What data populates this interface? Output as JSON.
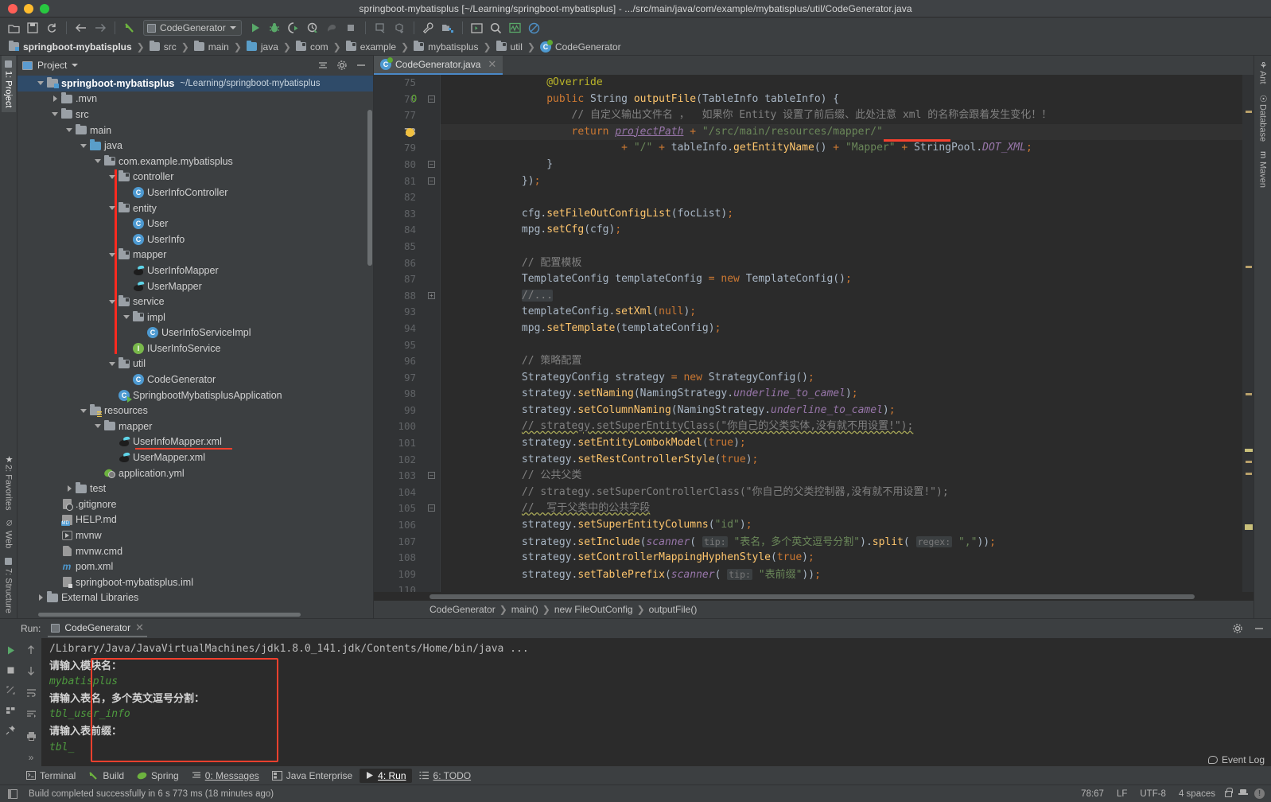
{
  "window": {
    "title": "springboot-mybatisplus [~/Learning/springboot-mybatisplus] - .../src/main/java/com/example/mybatisplus/util/CodeGenerator.java"
  },
  "toolbar": {
    "run_config": "CodeGenerator",
    "icons": [
      "open-folder-icon",
      "save-icon",
      "sync-icon",
      "back-arrow-icon",
      "forward-arrow-icon",
      "undo-icon",
      "run-icon",
      "debug-icon",
      "run-coverage-icon",
      "profile-icon",
      "stop-icon-dark",
      "stop-icon",
      "build-icon",
      "update-icon",
      "wrench-icon",
      "project-structure-icon",
      "console-icon",
      "search-icon",
      "monitor-icon",
      "block-icon"
    ]
  },
  "navbar": {
    "crumbs": [
      {
        "label": "springboot-mybatisplus",
        "icon": "module-icon"
      },
      {
        "label": "src",
        "icon": "folder-icon"
      },
      {
        "label": "main",
        "icon": "folder-icon"
      },
      {
        "label": "java",
        "icon": "source-folder-icon"
      },
      {
        "label": "com",
        "icon": "package-icon"
      },
      {
        "label": "example",
        "icon": "package-icon"
      },
      {
        "label": "mybatisplus",
        "icon": "package-icon"
      },
      {
        "label": "util",
        "icon": "package-icon"
      },
      {
        "label": "CodeGenerator",
        "icon": "java-class-icon"
      }
    ]
  },
  "left_rail": {
    "top": [
      {
        "label": "1: Project",
        "active": true
      }
    ],
    "bottom": [
      {
        "label": "2: Favorites"
      },
      {
        "label": "Web"
      },
      {
        "label": "7: Structure"
      }
    ]
  },
  "right_rail": {
    "items": [
      {
        "label": "Ant"
      },
      {
        "label": "Database"
      },
      {
        "label": "Maven"
      }
    ]
  },
  "project_panel": {
    "title": "Project",
    "tree": [
      {
        "indent": 0,
        "arrow": "down",
        "icon": "module-icon",
        "label": "springboot-mybatisplus",
        "path": "~/Learning/springboot-mybatisplus",
        "selected": true,
        "bold": true
      },
      {
        "indent": 1,
        "arrow": "right",
        "icon": "folder-icon",
        "label": ".mvn"
      },
      {
        "indent": 1,
        "arrow": "down",
        "icon": "folder-icon",
        "label": "src"
      },
      {
        "indent": 2,
        "arrow": "down",
        "icon": "folder-icon",
        "label": "main"
      },
      {
        "indent": 3,
        "arrow": "down",
        "icon": "source-folder-icon",
        "label": "java"
      },
      {
        "indent": 4,
        "arrow": "down",
        "icon": "package-icon",
        "label": "com.example.mybatisplus"
      },
      {
        "indent": 5,
        "arrow": "down",
        "icon": "package-icon",
        "label": "controller"
      },
      {
        "indent": 6,
        "arrow": "none",
        "icon": "java-class-icon",
        "label": "UserInfoController"
      },
      {
        "indent": 5,
        "arrow": "down",
        "icon": "package-icon",
        "label": "entity"
      },
      {
        "indent": 6,
        "arrow": "none",
        "icon": "java-class-icon",
        "label": "User"
      },
      {
        "indent": 6,
        "arrow": "none",
        "icon": "java-class-icon",
        "label": "UserInfo"
      },
      {
        "indent": 5,
        "arrow": "down",
        "icon": "package-icon",
        "label": "mapper"
      },
      {
        "indent": 6,
        "arrow": "none",
        "icon": "mybatis-icon",
        "label": "UserInfoMapper"
      },
      {
        "indent": 6,
        "arrow": "none",
        "icon": "mybatis-icon",
        "label": "UserMapper"
      },
      {
        "indent": 5,
        "arrow": "down",
        "icon": "package-icon",
        "label": "service"
      },
      {
        "indent": 6,
        "arrow": "down",
        "icon": "package-icon",
        "label": "impl"
      },
      {
        "indent": 7,
        "arrow": "none",
        "icon": "java-class-icon",
        "label": "UserInfoServiceImpl"
      },
      {
        "indent": 6,
        "arrow": "none",
        "icon": "java-interface-icon",
        "label": "IUserInfoService"
      },
      {
        "indent": 5,
        "arrow": "down",
        "icon": "package-icon",
        "label": "util"
      },
      {
        "indent": 6,
        "arrow": "none",
        "icon": "java-class-icon",
        "label": "CodeGenerator"
      },
      {
        "indent": 5,
        "arrow": "none",
        "icon": "spring-boot-icon",
        "label": "SpringbootMybatisplusApplication"
      },
      {
        "indent": 3,
        "arrow": "down",
        "icon": "resources-folder-icon",
        "label": "resources"
      },
      {
        "indent": 4,
        "arrow": "down",
        "icon": "folder-icon",
        "label": "mapper"
      },
      {
        "indent": 5,
        "arrow": "none",
        "icon": "mybatis-icon",
        "label": "UserInfoMapper.xml",
        "underlined": true
      },
      {
        "indent": 5,
        "arrow": "none",
        "icon": "mybatis-icon",
        "label": "UserMapper.xml"
      },
      {
        "indent": 4,
        "arrow": "none",
        "icon": "yaml-spring-icon",
        "label": "application.yml"
      },
      {
        "indent": 2,
        "arrow": "right",
        "icon": "folder-icon",
        "label": "test"
      },
      {
        "indent": 1,
        "arrow": "none",
        "icon": "gitignore-icon",
        "label": ".gitignore"
      },
      {
        "indent": 1,
        "arrow": "none",
        "icon": "markdown-icon",
        "label": "HELP.md"
      },
      {
        "indent": 1,
        "arrow": "none",
        "icon": "script-icon",
        "label": "mvnw"
      },
      {
        "indent": 1,
        "arrow": "none",
        "icon": "file-icon",
        "label": "mvnw.cmd"
      },
      {
        "indent": 1,
        "arrow": "none",
        "icon": "maven-pom-icon",
        "label": "pom.xml"
      },
      {
        "indent": 1,
        "arrow": "none",
        "icon": "iml-icon",
        "label": "springboot-mybatisplus.iml"
      },
      {
        "indent": 0,
        "arrow": "right",
        "icon": "library-icon",
        "label": "External Libraries"
      }
    ]
  },
  "editor": {
    "tab": {
      "label": "CodeGenerator.java",
      "icon": "java-class-icon"
    },
    "lines": [
      {
        "n": "75",
        "html": "                <span class=\"ann\">@Override</span>"
      },
      {
        "n": "76",
        "html": "                <span class=\"kw\">public</span> <span class=\"cls\">String</span> <span class=\"fn\">outputFile</span>(<span class=\"cls\">TableInfo</span> tableInfo) {",
        "override": true,
        "fold": "minus"
      },
      {
        "n": "77",
        "html": "                    <span class=\"cmt\">// 自定义输出文件名 ，  如果你 Entity 设置了前后缀、此处注意 xml 的名称会跟着发生变化！！</span>"
      },
      {
        "n": "78",
        "html": "                    <span class=\"kw\">return</span> <span class=\"link-u\">projectPath</span> <span class=\"sem\">+</span> <span class=\"str\">\"/src/main/resources/mapper/\"</span>",
        "current": true,
        "bulb": true
      },
      {
        "n": "79",
        "html": "                            <span class=\"sem\">+</span> <span class=\"str\">\"/\"</span> <span class=\"sem\">+</span> tableInfo.<span class=\"fn\">getEntityName</span>() <span class=\"sem\">+</span> <span class=\"str\">\"Mapper\"</span> <span class=\"sem\">+</span> <span class=\"cls\">StringPool</span>.<span class=\"fld\">DOT_XML</span><span class=\"sem\">;</span>"
      },
      {
        "n": "80",
        "html": "                }",
        "fold": "minus"
      },
      {
        "n": "81",
        "html": "            })<span class=\"sem\">;</span>",
        "fold": "minus"
      },
      {
        "n": "82",
        "html": ""
      },
      {
        "n": "83",
        "html": "            cfg.<span class=\"fn\">setFileOutConfigList</span>(focList)<span class=\"sem\">;</span>"
      },
      {
        "n": "84",
        "html": "            mpg.<span class=\"fn\">setCfg</span>(cfg)<span class=\"sem\">;</span>"
      },
      {
        "n": "85",
        "html": ""
      },
      {
        "n": "86",
        "html": "            <span class=\"cmt\">// 配置模板</span>"
      },
      {
        "n": "87",
        "html": "            <span class=\"cls\">TemplateConfig</span> templateConfig <span class=\"sem\">=</span> <span class=\"kw\">new</span> <span class=\"cls\">TemplateConfig</span>()<span class=\"sem\">;</span>"
      },
      {
        "n": "88",
        "html": "            <span class=\"fold-ph\">//...</span>",
        "fold": "plus"
      },
      {
        "n": "93",
        "html": "            templateConfig.<span class=\"fn\">setXml</span>(<span class=\"kw\">null</span>)<span class=\"sem\">;</span>"
      },
      {
        "n": "94",
        "html": "            mpg.<span class=\"fn\">setTemplate</span>(templateConfig)<span class=\"sem\">;</span>"
      },
      {
        "n": "95",
        "html": ""
      },
      {
        "n": "96",
        "html": "            <span class=\"cmt\">// 策略配置</span>"
      },
      {
        "n": "97",
        "html": "            <span class=\"cls\">StrategyConfig</span> strategy <span class=\"sem\">=</span> <span class=\"kw\">new</span> <span class=\"cls\">StrategyConfig</span>()<span class=\"sem\">;</span>"
      },
      {
        "n": "98",
        "html": "            strategy.<span class=\"fn\">setNaming</span>(<span class=\"cls\">NamingStrategy</span>.<span class=\"fld\">underline_to_camel</span>)<span class=\"sem\">;</span>"
      },
      {
        "n": "99",
        "html": "            strategy.<span class=\"fn\">setColumnNaming</span>(<span class=\"cls\">NamingStrategy</span>.<span class=\"fld\">underline_to_camel</span>)<span class=\"sem\">;</span>"
      },
      {
        "n": "100",
        "html": "            <span class=\"cmt warn-u\">// strategy.setSuperEntityClass(\"你自己的父类实体,没有就不用设置!\");</span>"
      },
      {
        "n": "101",
        "html": "            strategy.<span class=\"fn\">setEntityLombokModel</span>(<span class=\"kw\">true</span>)<span class=\"sem\">;</span>"
      },
      {
        "n": "102",
        "html": "            strategy.<span class=\"fn\">setRestControllerStyle</span>(<span class=\"kw\">true</span>)<span class=\"sem\">;</span>"
      },
      {
        "n": "103",
        "html": "            <span class=\"cmt\">// 公共父类</span>",
        "fold": "minus"
      },
      {
        "n": "104",
        "html": "            <span class=\"cmt\">// strategy.setSuperControllerClass(\"你自己的父类控制器,没有就不用设置!\");</span>"
      },
      {
        "n": "105",
        "html": "            <span class=\"cmt warn-u\">//  写于父类中的公共字段</span>",
        "fold": "minus"
      },
      {
        "n": "106",
        "html": "            strategy.<span class=\"fn\">setSuperEntityColumns</span>(<span class=\"str\">\"id\"</span>)<span class=\"sem\">;</span>"
      },
      {
        "n": "107",
        "html": "            strategy.<span class=\"fn\">setInclude</span>(<span class=\"fld\">scanner</span>( <span class=\"param-hint\">tip:</span> <span class=\"str\">\"表名，多个英文逗号分割\"</span>).<span class=\"fn\">split</span>( <span class=\"param-hint\">regex:</span> <span class=\"str\">\",\"</span>))<span class=\"sem\">;</span>"
      },
      {
        "n": "108",
        "html": "            strategy.<span class=\"fn\">setControllerMappingHyphenStyle</span>(<span class=\"kw\">true</span>)<span class=\"sem\">;</span>"
      },
      {
        "n": "109",
        "html": "            strategy.<span class=\"fn\">setTablePrefix</span>(<span class=\"fld\">scanner</span>( <span class=\"param-hint\">tip:</span> <span class=\"str\">\"表前缀\"</span>))<span class=\"sem\">;</span>"
      },
      {
        "n": "110",
        "html": ""
      }
    ],
    "breadcrumb": [
      "CodeGenerator",
      "main()",
      "new FileOutConfig",
      "outputFile()"
    ]
  },
  "run_panel": {
    "label": "Run:",
    "tab": "CodeGenerator",
    "console": [
      {
        "text": "/Library/Java/JavaVirtualMachines/jdk1.8.0_141.jdk/Contents/Home/bin/java ...",
        "type": "mono"
      },
      {
        "text": "请输入模块名：",
        "type": "cn"
      },
      {
        "text": "mybatisplus",
        "type": "input"
      },
      {
        "text": "请输入表名，多个英文逗号分割：",
        "type": "cn"
      },
      {
        "text": "tbl_user_info",
        "type": "input"
      },
      {
        "text": "请输入表前缀：",
        "type": "cn"
      },
      {
        "text": "tbl_",
        "type": "input"
      }
    ]
  },
  "bottom_tabs": [
    {
      "label": "Terminal",
      "icon": "terminal-icon",
      "active": false
    },
    {
      "label": "Build",
      "icon": "build-icon",
      "active": false
    },
    {
      "label": "Spring",
      "icon": "spring-icon",
      "active": false
    },
    {
      "label": "0: Messages",
      "icon": "messages-icon",
      "active": false,
      "mnemonic": "0"
    },
    {
      "label": "Java Enterprise",
      "icon": "java-ee-icon",
      "active": false
    },
    {
      "label": "4: Run",
      "icon": "run-icon",
      "active": true,
      "mnemonic": "4"
    },
    {
      "label": "6: TODO",
      "icon": "todo-icon",
      "active": false,
      "mnemonic": "6"
    }
  ],
  "status_bar": {
    "message": "Build completed successfully in 6 s 773 ms (18 minutes ago)",
    "caret": "78:67",
    "line_separator": "LF",
    "encoding": "UTF-8",
    "indent": "4 spaces",
    "event_log": "Event Log"
  },
  "colors": {
    "accent_blue": "#4a88c7",
    "highlight_red": "#f4402e",
    "selection": "#2f4b69",
    "editor_bg": "#2b2b2b",
    "panel_bg": "#3c3f41",
    "string_green": "#6a8759",
    "keyword_orange": "#cc7832"
  }
}
